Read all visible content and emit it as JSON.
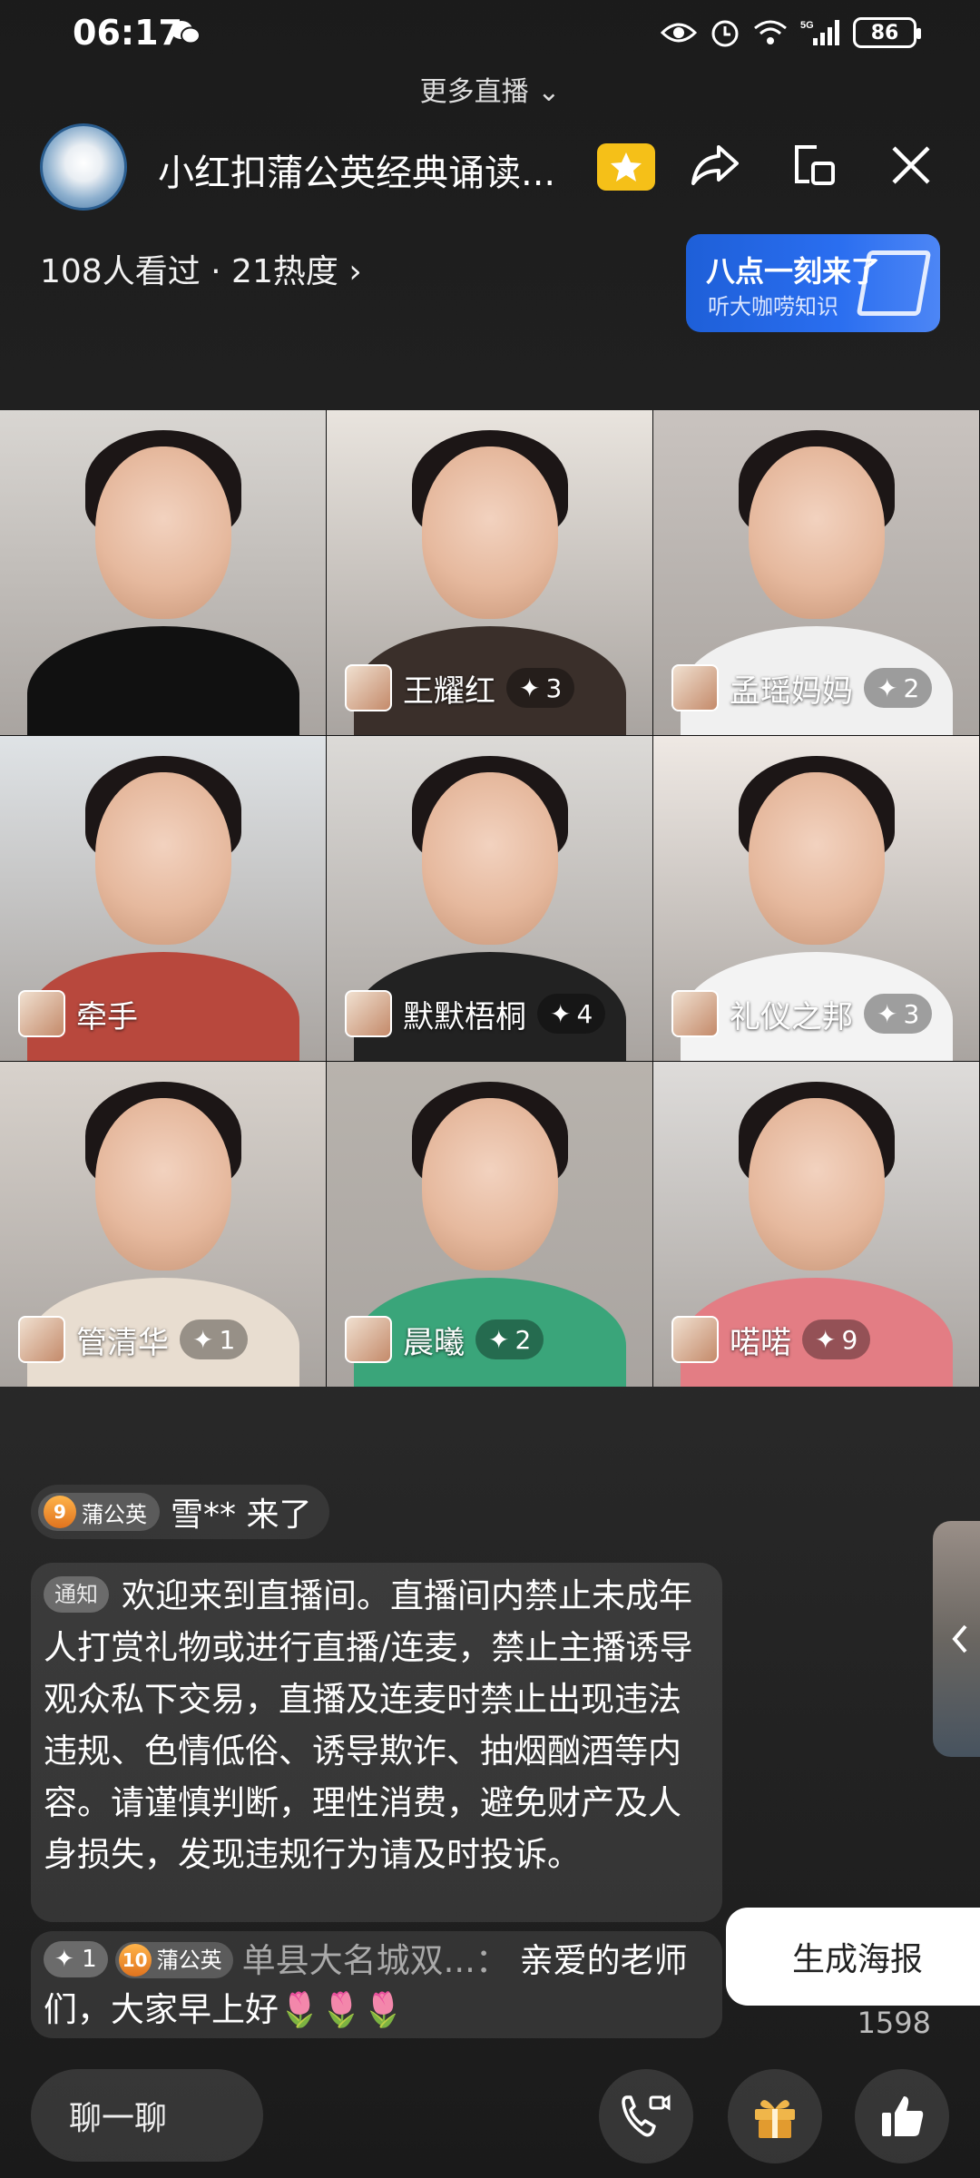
{
  "status_bar": {
    "time": "06:17",
    "battery": "86",
    "icons": [
      "wechat-icon",
      "eye-icon",
      "alarm-icon",
      "wifi-icon",
      "signal-5g-icon",
      "battery-icon"
    ]
  },
  "top": {
    "more_live": "更多直播"
  },
  "header": {
    "title": "小红扣蒲公英经典诵读...",
    "viewers": "108人看过 · 21热度",
    "promo": {
      "title": "八点一刻来了",
      "subtitle": "听大咖唠知识"
    }
  },
  "grid": [
    {
      "name": "",
      "likes": "",
      "bg": "#d9d6d2",
      "shirt": "#111111"
    },
    {
      "name": "王耀红",
      "likes": "3",
      "bg": "#e9e4de",
      "shirt": "#3a2f2a"
    },
    {
      "name": "孟瑶妈妈",
      "likes": "2",
      "bg": "#c9c3bf",
      "shirt": "#f0f0f0"
    },
    {
      "name": "牵手",
      "likes": "",
      "bg": "#dfe3e6",
      "shirt": "#b8483d"
    },
    {
      "name": "默默梧桐",
      "likes": "4",
      "bg": "#dcdad7",
      "shirt": "#222222"
    },
    {
      "name": "礼仪之邦",
      "likes": "3",
      "bg": "#efe9e4",
      "shirt": "#f3f3f3"
    },
    {
      "name": "管清华",
      "likes": "1",
      "bg": "#d8d2cc",
      "shirt": "#e8ddd0"
    },
    {
      "name": "晨曦",
      "likes": "2",
      "bg": "#b8b3ad",
      "shirt": "#3aa57a"
    },
    {
      "name": "喏喏",
      "likes": "9",
      "bg": "#dedcda",
      "shirt": "#e37d84"
    }
  ],
  "chat": {
    "join": {
      "level": "9",
      "badge": "蒲公英",
      "text": "雪** 来了"
    },
    "notice": {
      "tag": "通知",
      "text": "欢迎来到直播间。直播间内禁止未成年人打赏礼物或进行直播/连麦，禁止主播诱导观众私下交易，直播及连麦时禁止出现违法违规、色情低俗、诱导欺诈、抽烟酗酒等内容。请谨慎判断，理性消费，避免财产及人身损失，发现违规行为请及时投诉。"
    },
    "greeting": {
      "likes": "1",
      "level": "10",
      "badge": "蒲公英",
      "sender": "单县大名城双...",
      "text": "亲爱的老师们，大家早上好🌷🌷🌷"
    }
  },
  "actions": {
    "poster": "生成海报",
    "count": "1598",
    "chat_input": "聊一聊"
  },
  "colors": {
    "promo_blue": "#2a6ef0",
    "badge_yellow": "#f5c018"
  }
}
